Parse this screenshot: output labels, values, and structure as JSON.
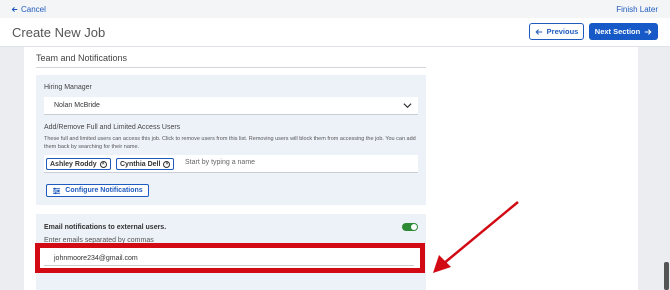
{
  "topbar": {
    "cancel_label": "Cancel",
    "finish_label": "Finish Later"
  },
  "header": {
    "title": "Create New Job",
    "previous_label": "Previous",
    "next_label": "Next Section"
  },
  "section": {
    "title": "Team and Notifications"
  },
  "hiring_manager": {
    "label": "Hiring Manager",
    "value": "Nolan McBride"
  },
  "access": {
    "label": "Add/Remove Full and Limited Access Users",
    "help": "These full and limited users can access this job. Click to remove users from this list. Removing users will block them from accessing the job. You can add them back by searching for their name.",
    "users": [
      "Ashley Roddy",
      "Cynthia Dell"
    ],
    "placeholder": "Start by typing a name",
    "configure_label": "Configure Notifications"
  },
  "external": {
    "label": "Email notifications to external users.",
    "enabled": true,
    "emails_label": "Enter emails separated by commas",
    "emails_value": "johnmoore234@gmail.com"
  },
  "colors": {
    "accent": "#1659c7",
    "toggle_on": "#2f8a35",
    "highlight": "#d10a14"
  }
}
